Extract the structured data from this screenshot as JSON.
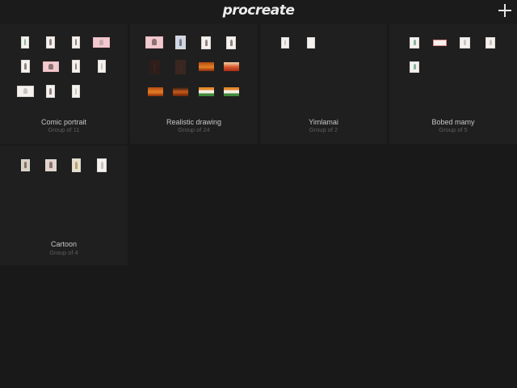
{
  "app": {
    "logo_text": "procreate"
  },
  "header": {
    "add_icon": "plus-icon"
  },
  "colors": {
    "background": "#191919",
    "stack_bg": "#1f1f1f",
    "text": "#c8c8c8",
    "subtext": "#5e5e5e"
  },
  "stacks": [
    {
      "name": "Comic portrait",
      "count": "Group of 11"
    },
    {
      "name": "Realistic drawing",
      "count": "Group of 24"
    },
    {
      "name": "Yimlamai",
      "count": "Group of 2"
    },
    {
      "name": "Bobed mamy",
      "count": "Group of 5"
    },
    {
      "name": "Cartoon",
      "count": "Group of 4"
    }
  ]
}
